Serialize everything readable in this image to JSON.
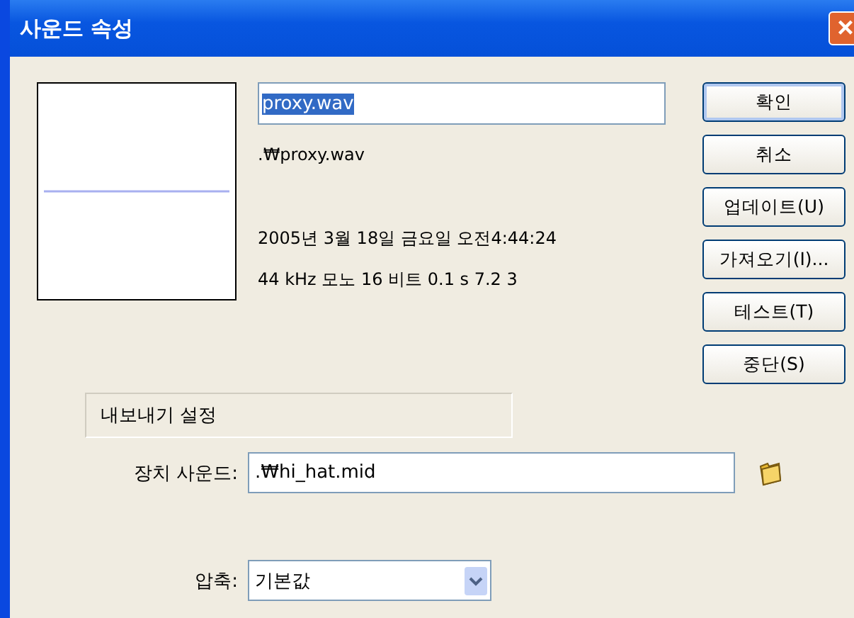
{
  "window": {
    "title": "사운드 속성",
    "close": "×"
  },
  "name_field": {
    "value": "proxy.wav",
    "selected": true
  },
  "path": ".₩proxy.wav",
  "date": "2005년 3월 18일 금요일  오전4:44:24",
  "info": "44 kHz 모노 16 비트 0.1 s 7.2 3",
  "buttons": [
    {
      "label": "확인",
      "default": true
    },
    {
      "label": "취소",
      "default": false
    },
    {
      "label": "업데이트(U)",
      "default": false
    },
    {
      "label": "가져오기(I)...",
      "default": false
    },
    {
      "label": "테스트(T)",
      "default": false
    },
    {
      "label": "중단(S)",
      "default": false
    }
  ],
  "export_settings": {
    "title": "내보내기 설정"
  },
  "device_sound": {
    "label": "장치 사운드:",
    "value": ".₩hi_hat.mid"
  },
  "compression": {
    "label": "압축:",
    "value": "기본값"
  }
}
